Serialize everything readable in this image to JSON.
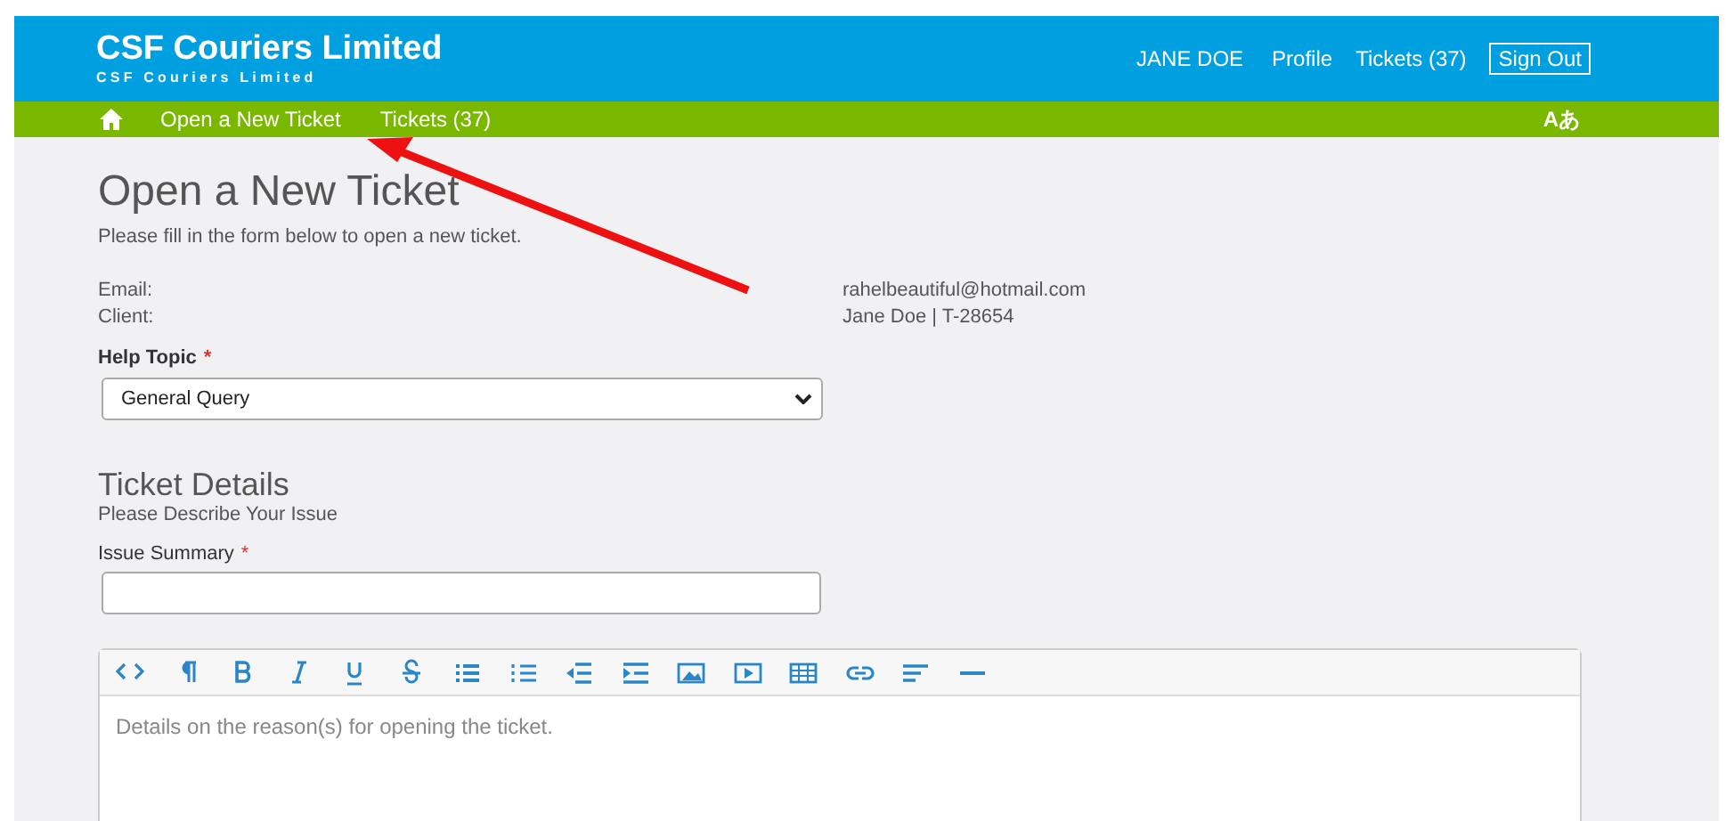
{
  "header": {
    "title": "CSF Couriers Limited",
    "subtitle": "CSF Couriers Limited",
    "user": "JANE DOE",
    "links": [
      "Profile",
      "Tickets (37)"
    ],
    "sign_out": "Sign Out"
  },
  "nav": {
    "items": [
      {
        "kind": "home"
      },
      {
        "kind": "link",
        "label": "Open a New Ticket"
      },
      {
        "kind": "link",
        "label": "Tickets (37)"
      }
    ],
    "language": "Aあ"
  },
  "page": {
    "title": "Open a New Ticket",
    "intro": "Please fill in the form below to open a new ticket."
  },
  "info": [
    {
      "label": "Email:",
      "value": "rahelbeautiful@hotmail.com"
    },
    {
      "label": "Client:",
      "value": "Jane Doe | T-28654"
    }
  ],
  "help_topic": {
    "label": "Help Topic",
    "required_mark": "*",
    "value": "General Query"
  },
  "details": {
    "title": "Ticket Details",
    "subtitle": "Please Describe Your Issue"
  },
  "issue_summary": {
    "label": "Issue Summary",
    "required_mark": "*"
  },
  "editor": {
    "placeholder": "Details on the reason(s) for opening the ticket."
  }
}
